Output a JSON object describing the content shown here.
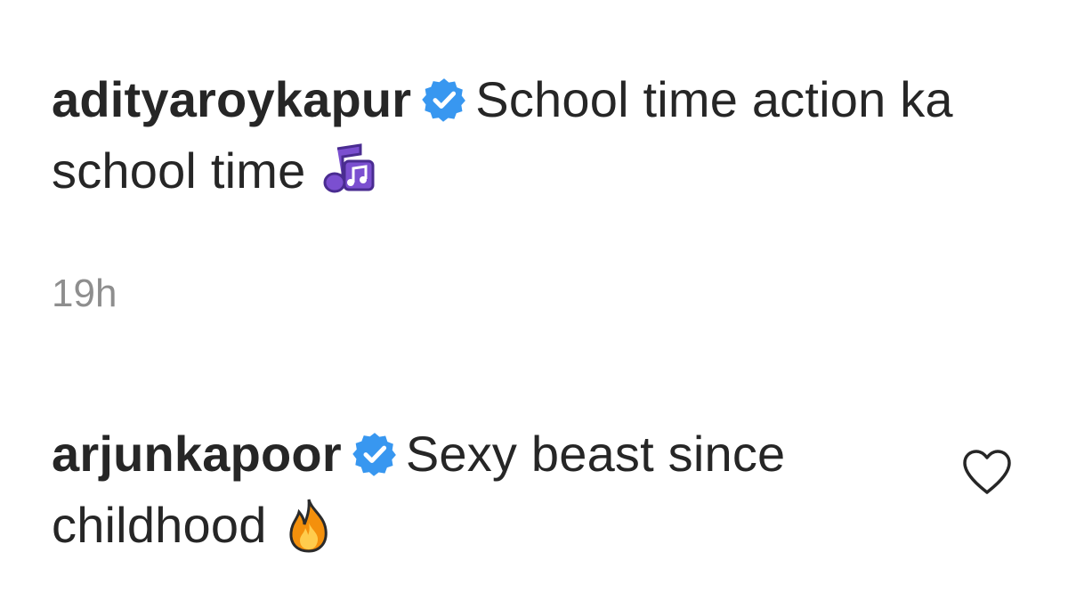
{
  "comments": [
    {
      "username": "adityaroykapur",
      "verified": true,
      "text": "School time action ka school time",
      "emoji": "musical-notes-icon",
      "timestamp": "19h"
    },
    {
      "username": "arjunkapoor",
      "verified": true,
      "text": "Sexy beast since childhood",
      "emoji": "fire-icon",
      "like_icon": "heart-outline-icon"
    }
  ],
  "colors": {
    "text": "#262626",
    "muted": "#8e8e8e",
    "verified_badge": "#3897f0",
    "music_emoji": "#7b4fd0",
    "fire_emoji": "#f4900c"
  }
}
